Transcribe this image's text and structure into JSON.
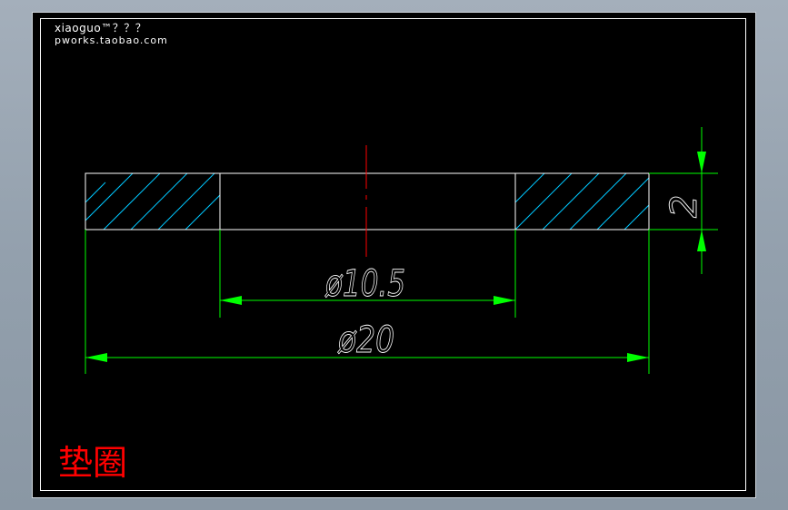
{
  "watermark": {
    "line1": "xiaoguo™？？？",
    "line2": "pworks.taobao.com"
  },
  "title": "垫圈",
  "dimensions": {
    "inner_diameter": "ø10.5",
    "outer_diameter": "ø20",
    "thickness": "2"
  },
  "colors": {
    "background": "#000000",
    "outline": "#ffffff",
    "dimension": "#00ff00",
    "hatch": "#00c8ff",
    "centerline": "#ff0000",
    "title": "#ff0000"
  },
  "icons": {
    "arrow": "solid-arrowhead"
  }
}
